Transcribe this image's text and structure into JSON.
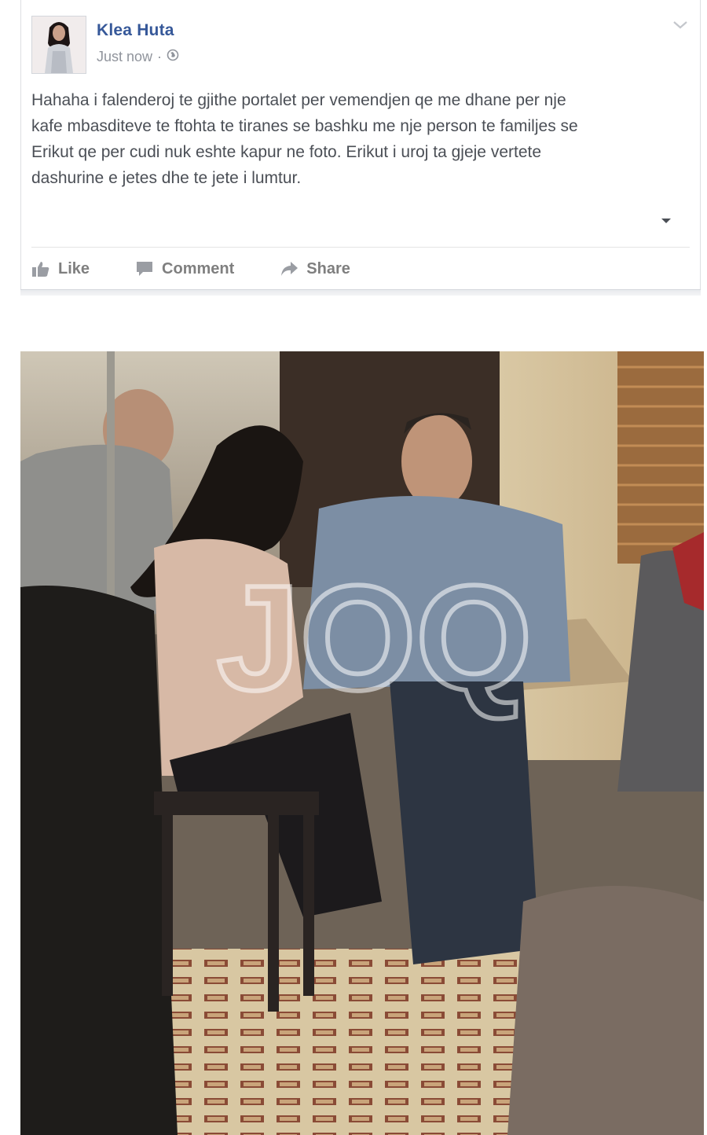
{
  "post": {
    "author": "Klea Huta",
    "timestamp": "Just now",
    "separator": "·",
    "privacy_icon": "globe-icon",
    "text_lines": [
      "Hahaha i falenderoj te gjithe portalet per vemendjen qe me dhane per nje",
      "kafe mbasditeve te ftohta te tiranes se bashku me nje person te familjes se",
      "Erikut qe per cudi nuk eshte kapur ne foto. Erikut i uroj ta gjeje vertete",
      "dashurine e jetes dhe te jete i lumtur."
    ]
  },
  "actions": {
    "like": "Like",
    "comment": "Comment",
    "share": "Share"
  },
  "photo": {
    "watermark": "JOQ"
  },
  "colors": {
    "author": "#365899",
    "action_text": "#7f7f7f",
    "meta_text": "#90949c"
  }
}
